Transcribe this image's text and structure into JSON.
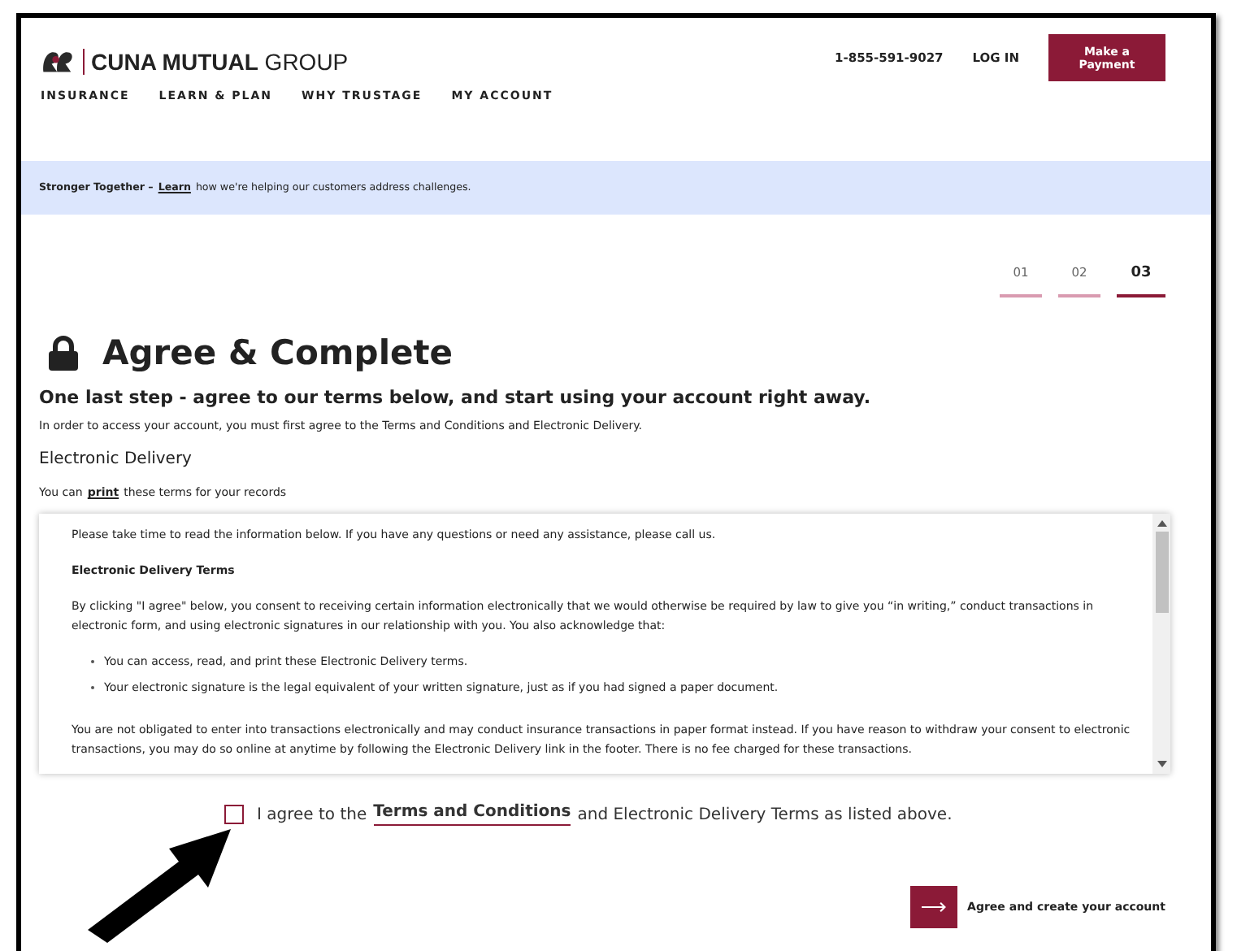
{
  "header": {
    "logo": "**CUNA MUTUAL** GROUP",
    "phone": "1-855-591-9027",
    "login": "LOG IN",
    "payment_button": "Make a Payment",
    "nav": [
      "INSURANCE",
      "LEARN & PLAN",
      "WHY TRUSTAGE",
      "MY ACCOUNT"
    ]
  },
  "banner": {
    "lead": "Stronger Together –",
    "link": "Learn",
    "rest": "how we're helping our customers address challenges."
  },
  "steps": [
    {
      "label": "01",
      "selected": false
    },
    {
      "label": "02",
      "selected": false
    },
    {
      "label": "03",
      "selected": true
    }
  ],
  "title": "Agree & Complete",
  "subtitle": "One last step - agree to our terms below, and start using your account right away.",
  "intro": "In order to access your account, you must first agree to the Terms and Conditions and Electronic Delivery.",
  "section_heading": "Electronic Delivery",
  "print_note": {
    "before": "You can",
    "link": "print",
    "after": "these terms for your records"
  },
  "terms": [
    {
      "kind": "paragraph",
      "text": "Please take time to read the information below. If you have any questions or need any assistance, please call us."
    },
    {
      "kind": "heading",
      "text": "Electronic Delivery Terms"
    },
    {
      "kind": "paragraph",
      "text": "By clicking \"I agree\" below, you consent to receiving certain information electronically that we would otherwise be required by law to give you “in writing,” conduct transactions in electronic form, and using electronic signatures in our relationship with you. You also acknowledge that:"
    },
    {
      "kind": "bullets",
      "items": [
        "You can access, read, and print these Electronic Delivery terms.",
        "Your electronic signature is the legal equivalent of your written signature, just as if you had signed a paper document."
      ]
    },
    {
      "kind": "paragraph",
      "text": "You are not obligated to enter into transactions electronically and may conduct insurance transactions in paper format instead. If you have reason to withdraw your consent to electronic transactions, you may do so online at anytime by following the Electronic Delivery link in the footer. There is no fee charged for these transactions."
    }
  ],
  "agree": {
    "checked": false,
    "before": "I agree to the",
    "link": "Terms and Conditions",
    "after": "and Electronic Delivery Terms as listed above."
  },
  "submit": {
    "label": "Agree and create your account"
  }
}
